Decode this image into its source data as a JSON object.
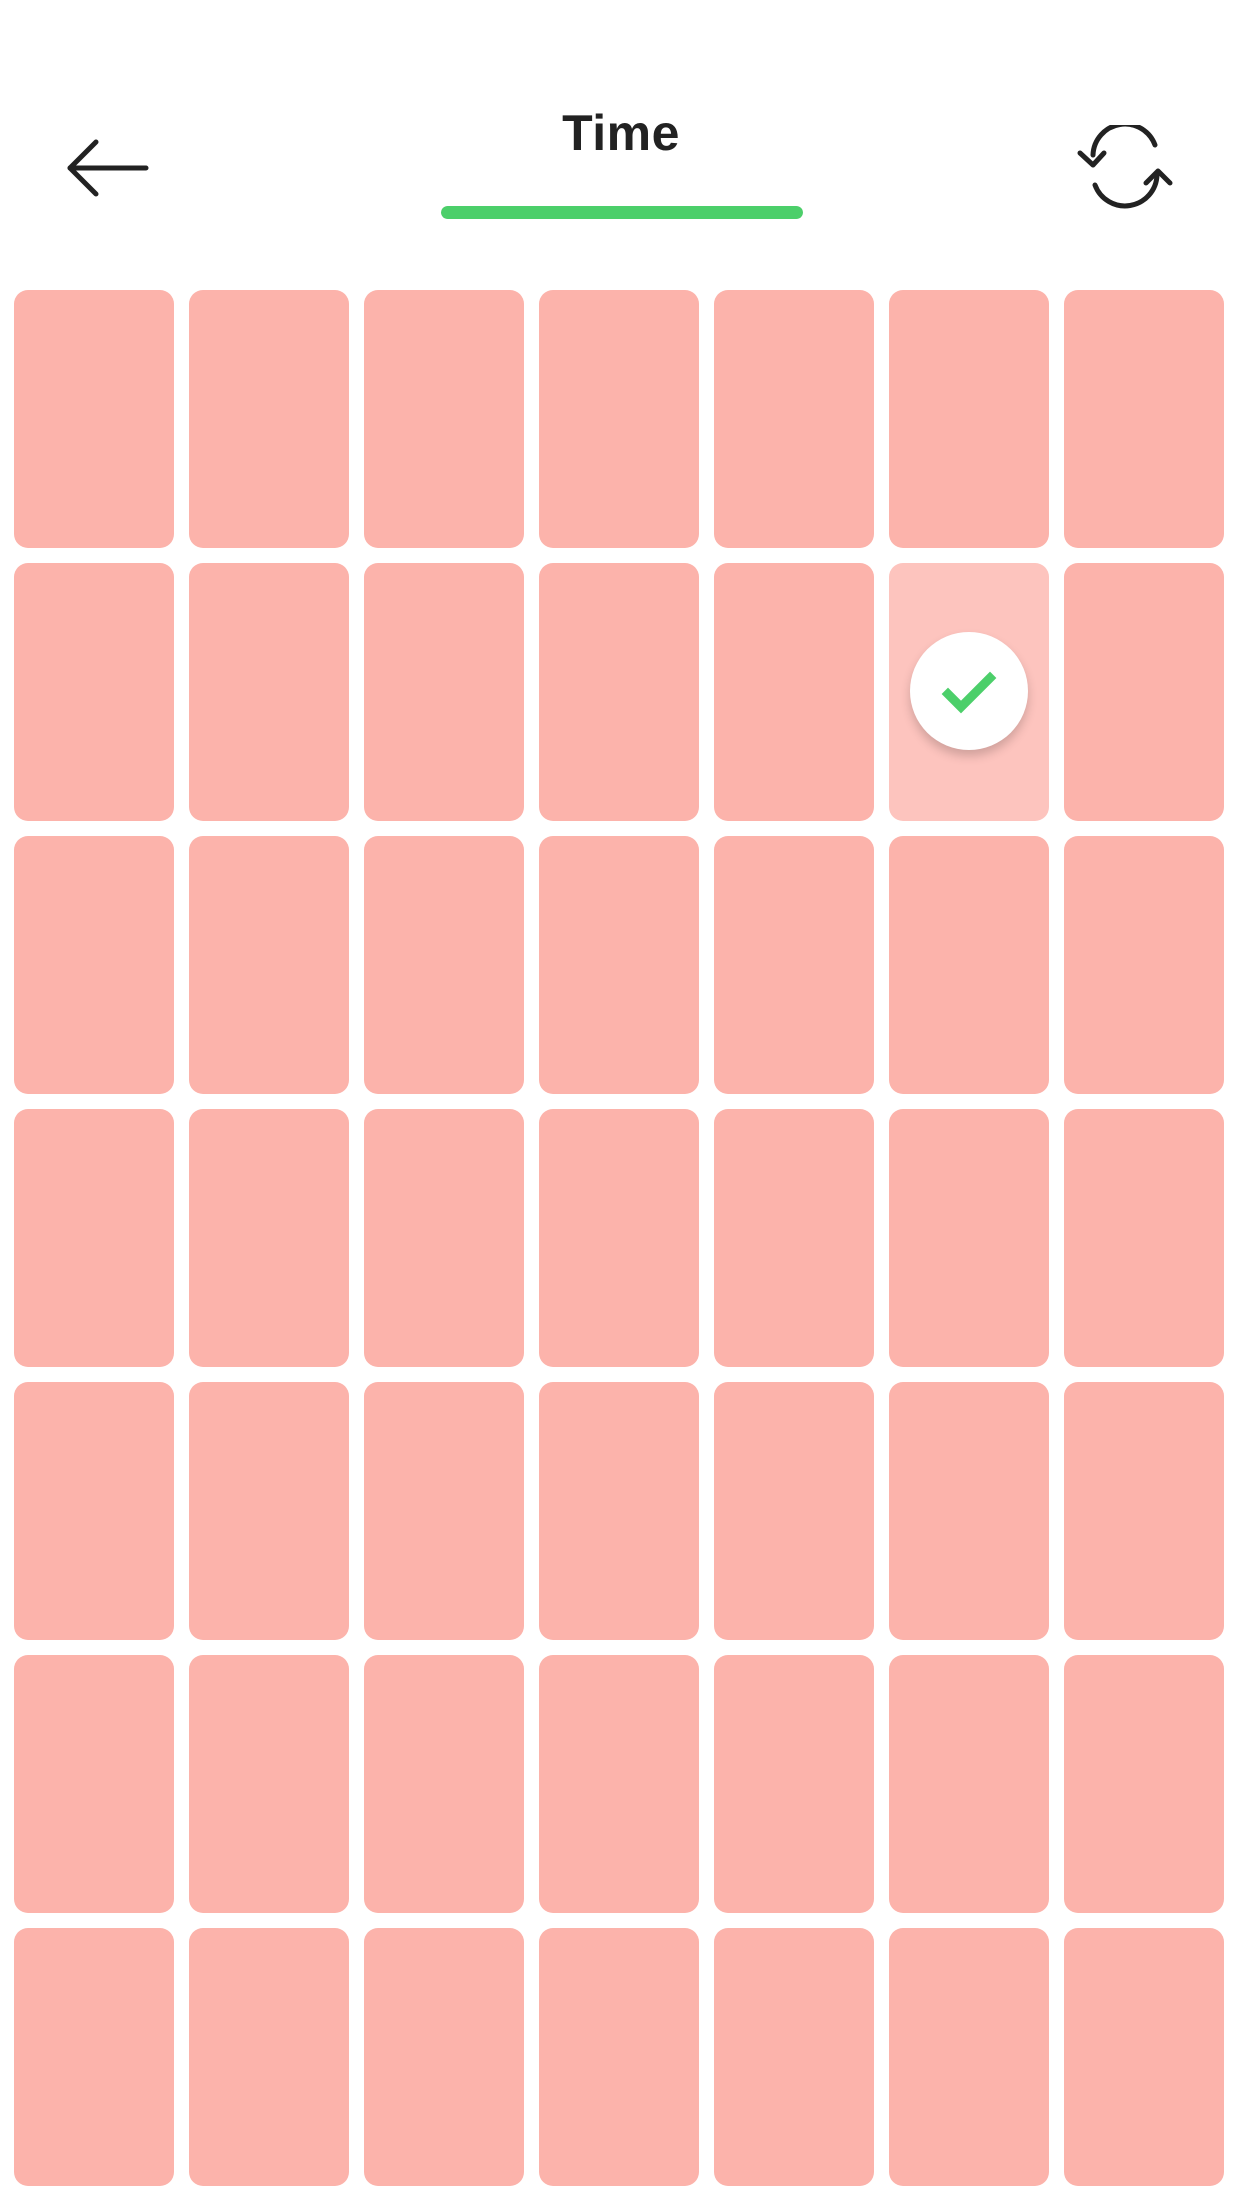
{
  "header": {
    "title": "Time",
    "back_icon": "arrow-left-icon",
    "refresh_icon": "refresh-icon",
    "progress": 1.0,
    "progress_color": "#4ccf6a"
  },
  "board": {
    "rows": 7,
    "columns": 7,
    "cell_color": "#fcb3ab",
    "selected_cell_color": "#fdc4be",
    "selected": {
      "row": 2,
      "column": 6
    },
    "selected_icon": "checkmark-icon",
    "check_color": "#4ccf6a"
  }
}
